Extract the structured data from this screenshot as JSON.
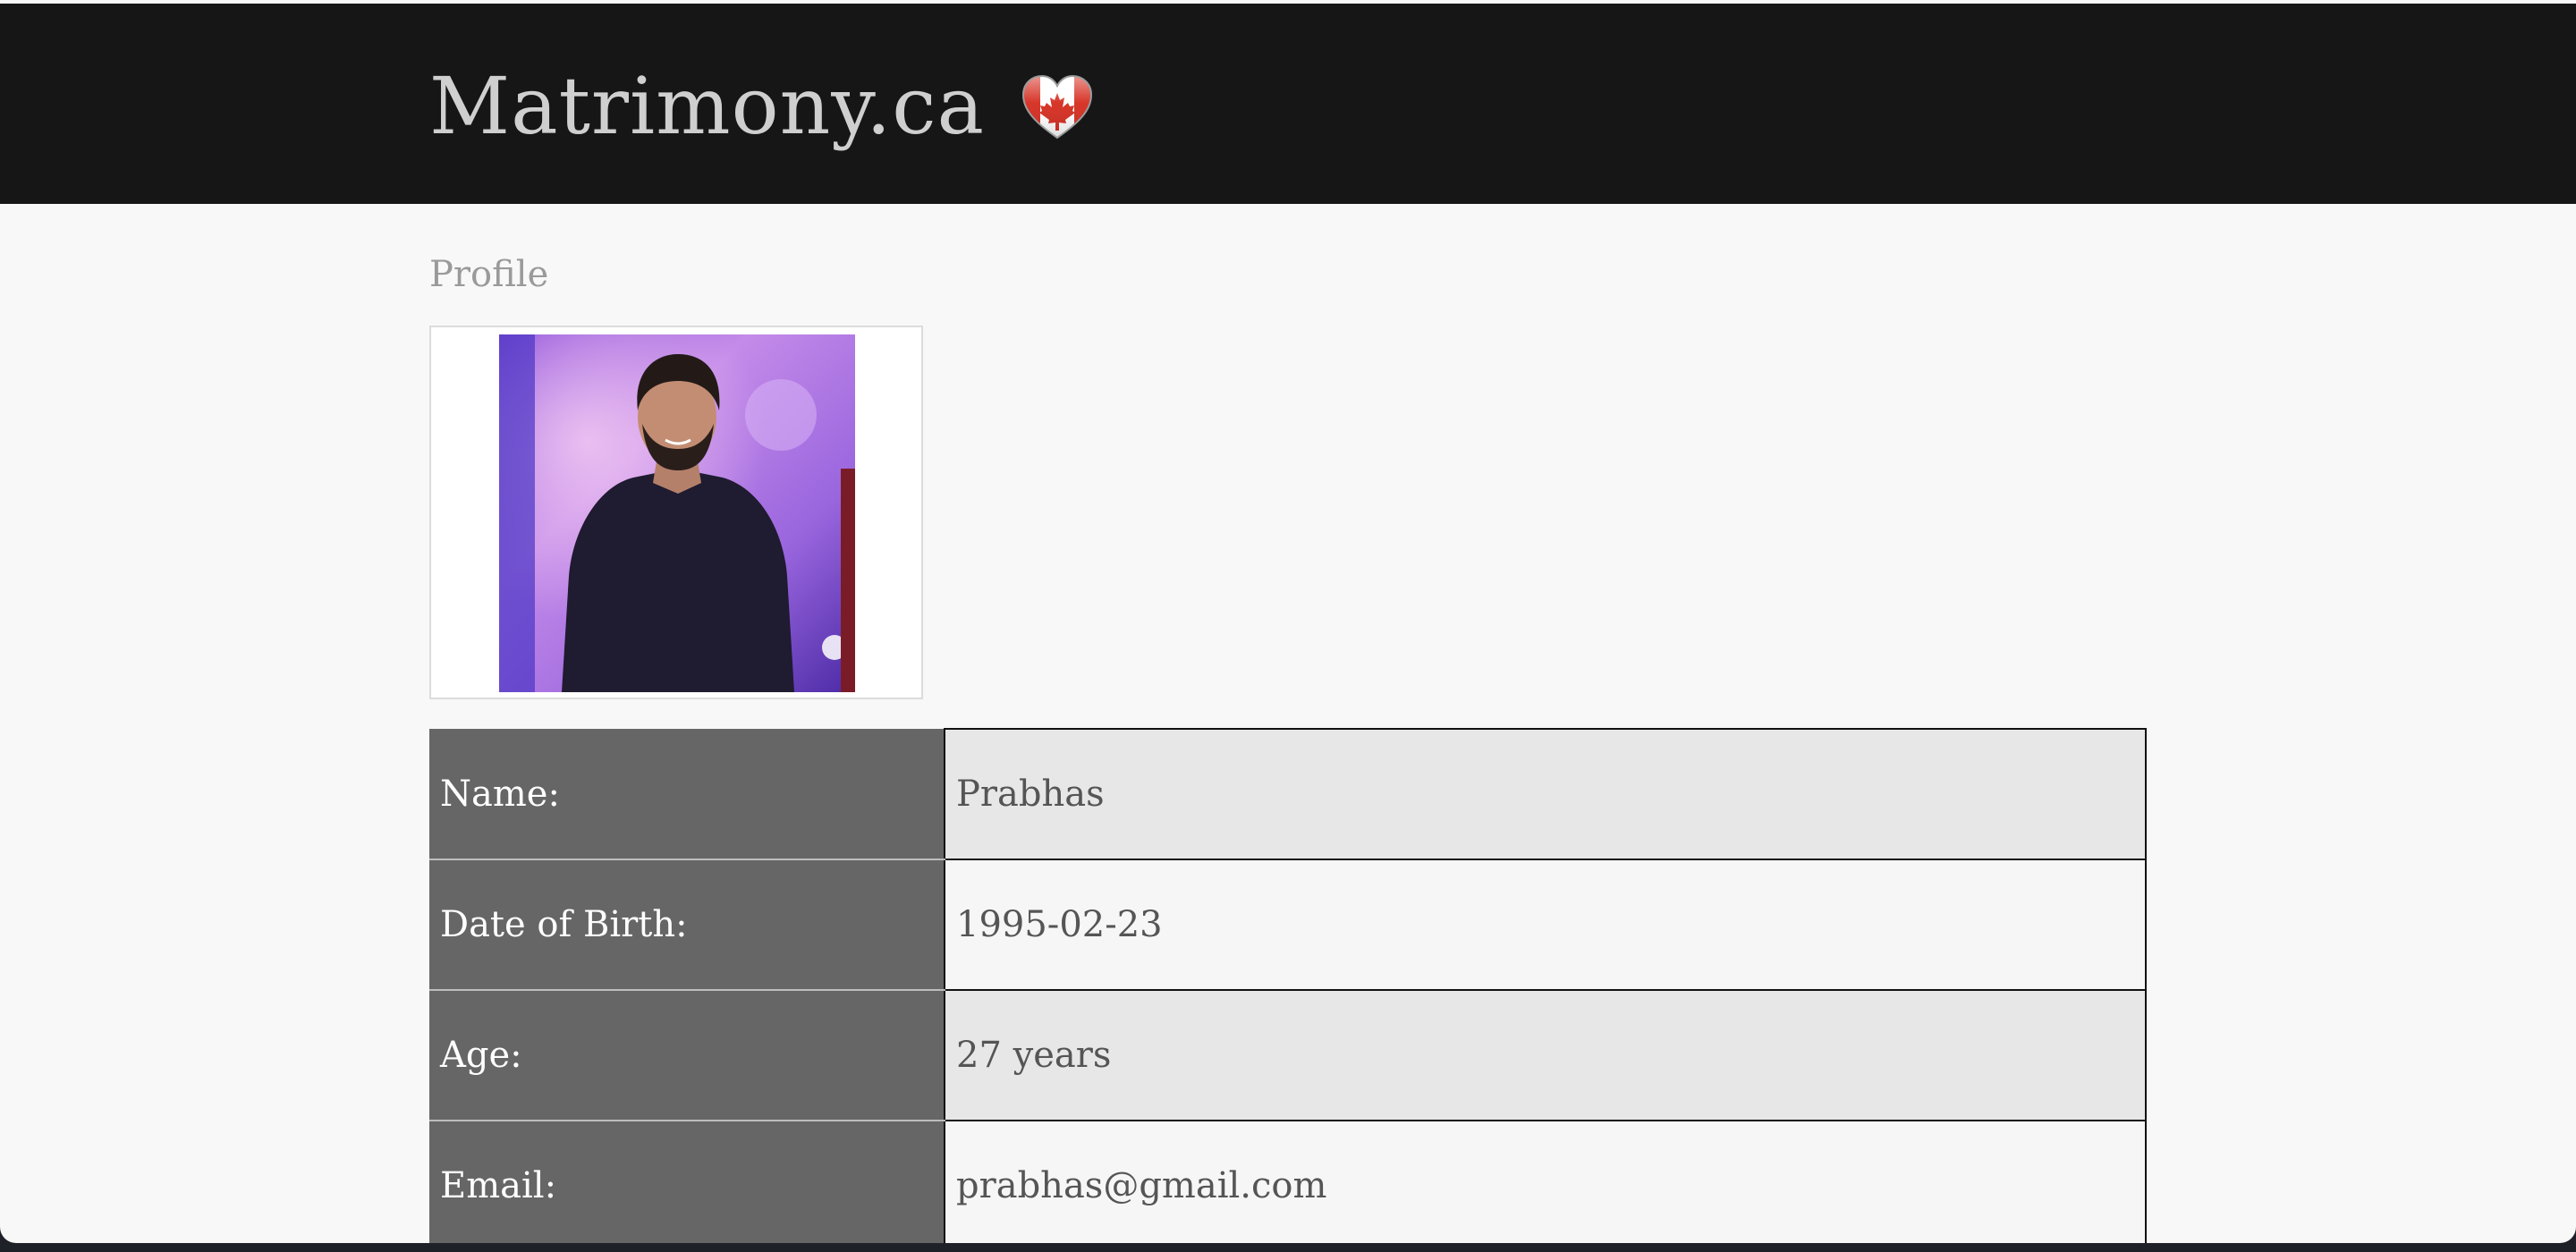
{
  "header": {
    "site_title": "Matrimony.ca",
    "flag_icon": "canada-flag-heart-icon"
  },
  "profile": {
    "section_title": "Profile",
    "photo_alt": "Profile photo",
    "rows": [
      {
        "label": "Name:",
        "value": "Prabhas"
      },
      {
        "label": "Date of Birth:",
        "value": "1995-02-23"
      },
      {
        "label": "Age:",
        "value": "27 years"
      },
      {
        "label": "Email:",
        "value": "prabhas@gmail.com"
      }
    ]
  },
  "colors": {
    "header_bg": "#161616",
    "page_bg": "#f8f8f8",
    "label_cell_bg": "#666666",
    "odd_value_bg": "#e7e7e7",
    "even_value_bg": "#f6f6f6"
  }
}
